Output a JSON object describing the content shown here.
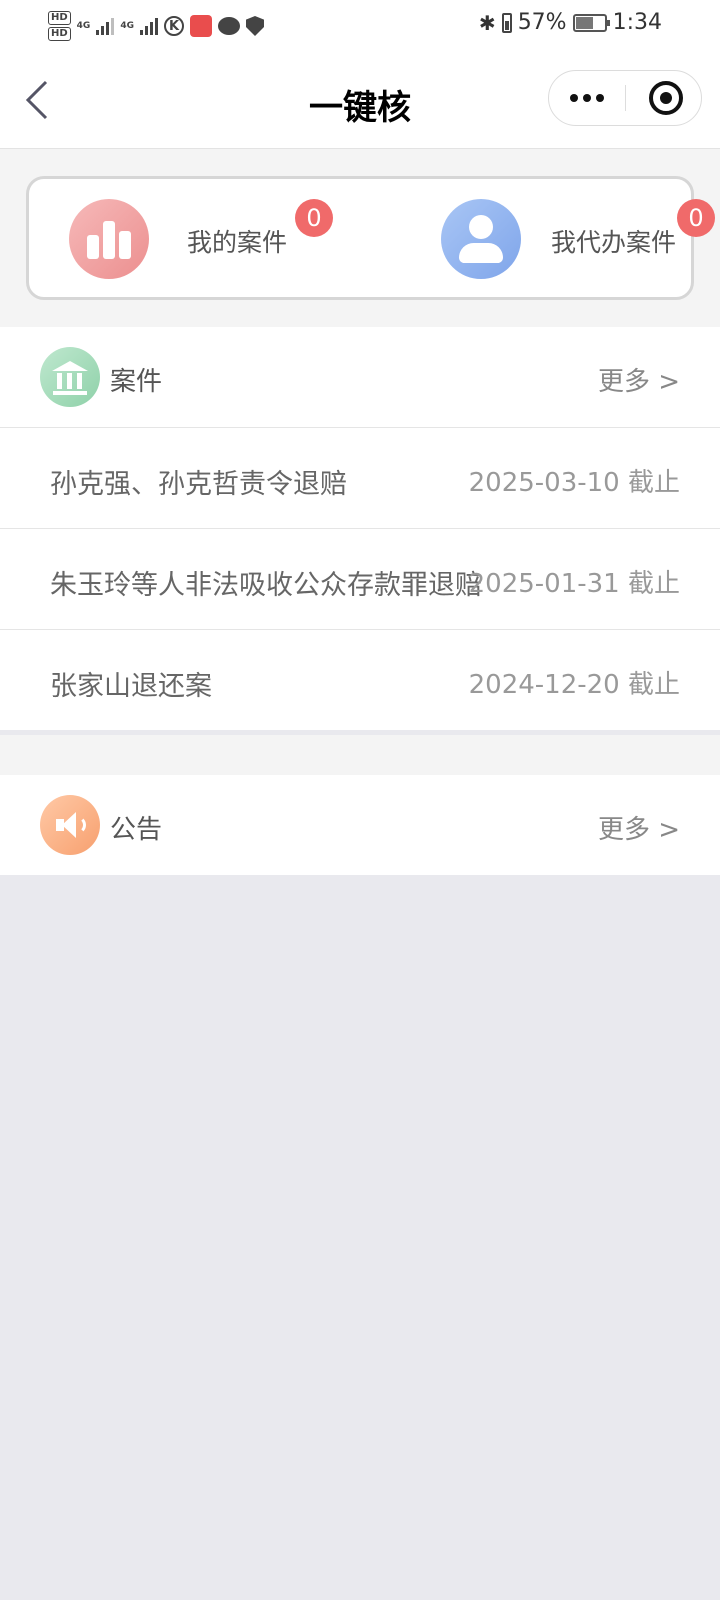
{
  "status_bar": {
    "signal_label_1": "4G",
    "signal_label_2": "4G",
    "k_icon_text": "K",
    "battery_percent": "57%",
    "time": "1:34"
  },
  "nav": {
    "title": "一键核"
  },
  "shortcuts": [
    {
      "label": "我的案件",
      "badge": "0",
      "icon": "bar-chart-icon"
    },
    {
      "label": "我代办案件",
      "badge": "0",
      "icon": "user-icon"
    }
  ],
  "cases": {
    "title": "案件",
    "more": "更多 >",
    "items": [
      {
        "title": "孙克强、孙克哲责令退赔",
        "date": "2025-03-10 截止"
      },
      {
        "title": "朱玉玲等人非法吸收公众存款罪退赔",
        "date": "2025-01-31 截止"
      },
      {
        "title": "张家山退还案",
        "date": "2024-12-20 截止"
      }
    ]
  },
  "notices": {
    "title": "公告",
    "more": "更多 >"
  },
  "colors": {
    "badge": "#f06a6a",
    "bank_icon": "#8fd1a9",
    "speaker_icon": "#f7a06f",
    "chart_icon": "#ec8f8f",
    "user_icon": "#7fa5ea",
    "page_bg": "#e9e9ee"
  }
}
